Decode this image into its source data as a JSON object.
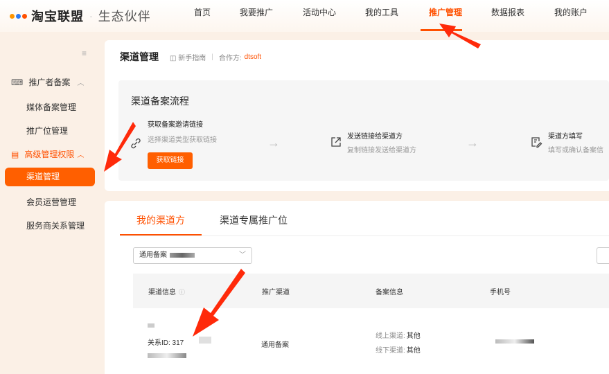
{
  "brand": {
    "name": "淘宝联盟",
    "separator": "·",
    "sub": "生态伙伴"
  },
  "nav": [
    {
      "label": "首页",
      "active": false
    },
    {
      "label": "我要推广",
      "active": false
    },
    {
      "label": "活动中心",
      "active": false
    },
    {
      "label": "我的工具",
      "active": false
    },
    {
      "label": "推广管理",
      "active": true
    },
    {
      "label": "数据报表",
      "active": false
    },
    {
      "label": "我的账户",
      "active": false
    }
  ],
  "sidebar": {
    "groups": [
      {
        "label": "推广者备案",
        "items": [
          "媒体备案管理",
          "推广位管理"
        ]
      },
      {
        "label": "高级管理权限",
        "items": [
          "渠道管理",
          "会员运营管理",
          "服务商关系管理"
        ]
      }
    ],
    "active_item": "渠道管理"
  },
  "header": {
    "title": "渠道管理",
    "guide": "新手指南",
    "partner_label": "合作方:",
    "partner_value": "dtsoft"
  },
  "flow": {
    "title": "渠道备案流程",
    "steps": [
      {
        "title": "获取备案邀请链接",
        "desc": "选择渠道类型获取链接"
      },
      {
        "title": "发送链接给渠道方",
        "desc": "复制链接发送给渠道方"
      },
      {
        "title": "渠道方填写",
        "desc": "填写或确认备案信"
      }
    ],
    "button": "获取链接"
  },
  "tabs": {
    "active": "我的渠道方",
    "inactive": "渠道专属推广位"
  },
  "filter": {
    "selected": "通用备案"
  },
  "table": {
    "headers": [
      "渠道信息",
      "推广渠道",
      "备案信息",
      "手机号"
    ],
    "row": {
      "relation_id": "关系ID: 317",
      "channel": "通用备案",
      "online": "线上渠道:",
      "online_val": "其他",
      "offline": "线下渠道:",
      "offline_val": "其他"
    }
  },
  "colors": {
    "accent": "#ff5000"
  }
}
